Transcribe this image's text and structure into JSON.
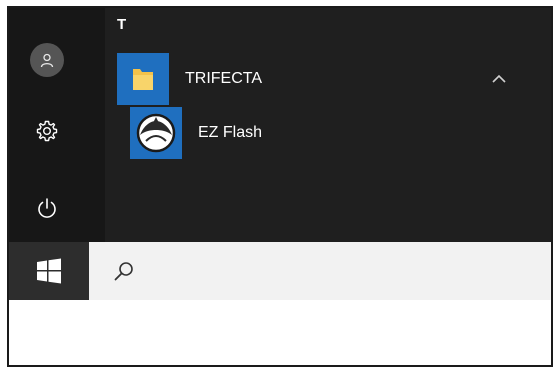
{
  "start_menu": {
    "letter_header": "T",
    "group": {
      "label": "TRIFECTA",
      "expanded": true,
      "icon": "folder-icon",
      "chevron_icon": "chevron-up-icon"
    },
    "apps": [
      {
        "label": "EZ Flash",
        "icon": "ez-flash-app-icon"
      }
    ],
    "rail": {
      "user_icon": "user-avatar-icon",
      "settings_icon": "gear-icon",
      "power_icon": "power-icon"
    }
  },
  "taskbar": {
    "start_icon": "windows-logo-icon",
    "search_icon": "search-icon",
    "search_value": ""
  },
  "colors": {
    "menu_bg": "#1b1b1b",
    "accent_tile": "#1f6fbf",
    "taskbar_start_bg": "#2d2d2d",
    "search_bg": "#f2f2f2"
  }
}
